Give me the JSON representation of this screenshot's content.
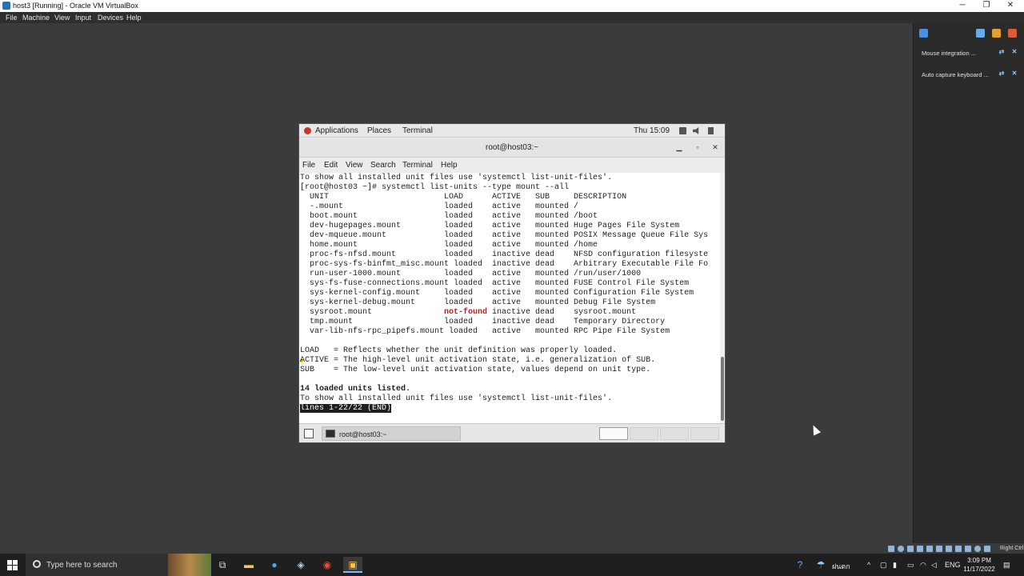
{
  "host_window": {
    "title": "host3 [Running] - Oracle VM VirtualBox",
    "minimize": "─",
    "restore": "❐",
    "close": "✕"
  },
  "host_menu": [
    "File",
    "Machine",
    "View",
    "Input",
    "Devices",
    "Help"
  ],
  "side_panel": {
    "notices": [
      {
        "text": "Mouse integration ..."
      },
      {
        "text": "Auto capture keyboard ..."
      }
    ]
  },
  "gnome_bar": {
    "applications": "Applications",
    "places": "Places",
    "terminal": "Terminal",
    "clock": "Thu 15:09"
  },
  "terminal_window": {
    "title": "root@host03:~",
    "minimize": "▁",
    "maximize": "▫",
    "close": "✕",
    "menu": [
      "File",
      "Edit",
      "View",
      "Search",
      "Terminal",
      "Help"
    ]
  },
  "terminal": {
    "line_intro": "To show all installed unit files use 'systemctl list-unit-files'.",
    "prompt": "[root@host03 ~]# systemctl list-units --type mount --all",
    "header": "  UNIT                        LOAD      ACTIVE   SUB     DESCRIPTION",
    "rows_before": [
      "  -.mount                     loaded    active   mounted /",
      "  boot.mount                  loaded    active   mounted /boot",
      "  dev-hugepages.mount         loaded    active   mounted Huge Pages File System",
      "  dev-mqueue.mount            loaded    active   mounted POSIX Message Queue File Sys",
      "  home.mount                  loaded    active   mounted /home",
      "  proc-fs-nfsd.mount          loaded    inactive dead    NFSD configuration filesyste",
      "  proc-sys-fs-binfmt_misc.mount loaded  inactive dead    Arbitrary Executable File Fo",
      "  run-user-1000.mount         loaded    active   mounted /run/user/1000",
      "  sys-fs-fuse-connections.mount loaded  active   mounted FUSE Control File System",
      "  sys-kernel-config.mount     loaded    active   mounted Configuration File System",
      "  sys-kernel-debug.mount      loaded    active   mounted Debug File System"
    ],
    "notfound_unit": "  sysroot.mount               ",
    "notfound_load": "not-found",
    "notfound_rest": " inactive dead    sysroot.mount",
    "rows_after": [
      "  tmp.mount                   loaded    inactive dead    Temporary Directory",
      "  var-lib-nfs-rpc_pipefs.mount loaded   active   mounted RPC Pipe File System"
    ],
    "legend": [
      "LOAD   = Reflects whether the unit definition was properly loaded.",
      "ACTIVE = The high-level unit activation state, i.e. generalization of SUB.",
      "SUB    = The low-level unit activation state, values depend on unit type."
    ],
    "summary": "14 loaded units listed.",
    "line_outro": "To show all installed unit files use 'systemctl list-unit-files'.",
    "pager": "lines 1-22/22 (END)"
  },
  "guest_taskbar": {
    "task_label": "root@host03:~"
  },
  "vb_status": {
    "host_key": "Right Ctrl"
  },
  "win_taskbar": {
    "search_placeholder": "Type here to search",
    "weather": "ฝนตก",
    "language": "ENG",
    "time": "3:09 PM",
    "date": "11/17/2022"
  }
}
